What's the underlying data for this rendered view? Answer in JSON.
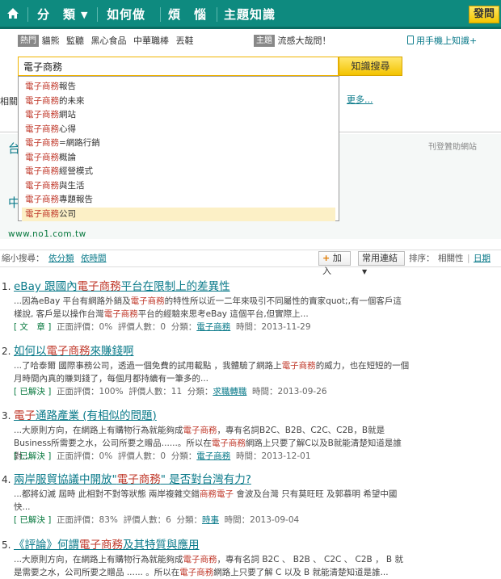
{
  "nav": {
    "items": [
      "分　類",
      "如何做",
      "煩　惱",
      "主題知識"
    ],
    "ask_label": "發問"
  },
  "hot": {
    "tag": "熱門",
    "items": [
      "貓熊",
      "監聽",
      "黑心食品",
      "中華職棒",
      "丟鞋"
    ],
    "theme_tag": "主題",
    "theme_text": "流感大哉問！",
    "mobile_text": "用手機上知識+"
  },
  "search": {
    "value": "電子商務",
    "button_label": "知識搜尋",
    "suggestions": [
      {
        "kw": "電子商務",
        "rest": "報告"
      },
      {
        "kw": "電子商務",
        "rest": "的未來"
      },
      {
        "kw": "電子商務",
        "rest": "網站"
      },
      {
        "kw": "電子商務",
        "rest": "心得"
      },
      {
        "kw": "電子商務",
        "rest": "=網路行銷"
      },
      {
        "kw": "電子商務",
        "rest": "概論"
      },
      {
        "kw": "電子商務",
        "rest": "經營模式"
      },
      {
        "kw": "電子商務",
        "rest": "與生活"
      },
      {
        "kw": "電子商務",
        "rest": "專題報告"
      },
      {
        "kw": "電子商務",
        "rest": "公司"
      }
    ]
  },
  "misc": {
    "related_prefix": "相關",
    "more": "更多...",
    "ad_label": "刊登贊助網站",
    "ad_url": "www.no1.com.tw",
    "ad_frag1": "台",
    "ad_frag2": "中"
  },
  "filter": {
    "label": "縮小搜尋：",
    "by_category": "依分類",
    "by_time": "依時間",
    "add_label": "加入",
    "links_label": "常用連結",
    "sort_label": "排序：",
    "sort_relevance": "相關性",
    "sort_date": "日期"
  },
  "results": [
    {
      "num": "1.",
      "title_pre": "eBay 跟國內",
      "title_kw": "電子商務",
      "title_post": "平台在限制上的差異性",
      "snip": [
        {
          "t": "...因為eBay 平台有網路外銷及"
        },
        {
          "t": "電子商務",
          "kw": true
        },
        {
          "t": "的特性所以近一二年來吸引不同屬性的賣家quot;,有一個客戶這樣說, 客戶是以操作台灣"
        },
        {
          "t": "電子商務",
          "kw": true
        },
        {
          "t": "平台的經驗來思考eBay 這個平台,但實際上..."
        }
      ],
      "status": "[ 文　章 ]",
      "rating": "正面評價：0%",
      "raters": "評價人數：0",
      "cat_label": "分類：",
      "cat": "電子商務",
      "time": "時間：2013-11-29"
    },
    {
      "num": "2.",
      "title_pre": "如何以",
      "title_kw": "電子商務",
      "title_post": "來賺錢啊",
      "snip": [
        {
          "t": "...了哈泰爾 國際事務公司，透過一個免費的試用載點 ，我體驗了網路上"
        },
        {
          "t": "電子商務",
          "kw": true
        },
        {
          "t": "的威力，也在短短的一個月時間內真的賺到錢了，每個月都持續有一筆多的..."
        }
      ],
      "status": "[ 已解決 ]",
      "rating": "正面評價：100%",
      "raters": "評價人數：11",
      "cat_label": "分類：",
      "cat": "求職轉職",
      "time": "時間：2013-09-26"
    },
    {
      "num": "3.",
      "title_pre": "",
      "title_kw": "電子",
      "title_post": "通路產業 (有相似的問題)",
      "snip": [
        {
          "t": "...大原則方向，在網路上有購物行為就能夠成"
        },
        {
          "t": "電子商務",
          "kw": true
        },
        {
          "t": "，專有名詞B2C、B2B、C2C、C2B，B就是Business所需要之水，公司所要之贈品......。所以在"
        },
        {
          "t": "電子商務",
          "kw": true
        },
        {
          "t": "網路上只要了解C以及B就能清楚知道是誰對..."
        }
      ],
      "status": "[ 已解決 ]",
      "rating": "正面評價：0%",
      "raters": "評價人數：0",
      "cat_label": "分類：",
      "cat": "電子商務",
      "time": "時間：2013-12-01"
    },
    {
      "num": "4.",
      "title_pre": "兩岸服貿協議中開放\"",
      "title_kw": "電子商務",
      "title_post": "\" 是否對台灣有力?",
      "snip": [
        {
          "t": "...都將幻滅 屆時 此相對不對等狀態 兩岸複雜交錯"
        },
        {
          "t": "商務電子",
          "kw": true
        },
        {
          "t": " 會波及台灣 只有莫旺旺 及郭慕明 希望中國快..."
        }
      ],
      "status": "[ 已解決 ]",
      "rating": "正面評價：83%",
      "raters": "評價人數：6",
      "cat_label": "分類：",
      "cat": "時事",
      "time": "時間：2013-09-04"
    },
    {
      "num": "5.",
      "title_pre": "《評論》何謂",
      "title_kw": "電子商務",
      "title_post": "及其特質與應用",
      "snip": [
        {
          "t": "...大原則方向，在網路上有購物行為就能夠成"
        },
        {
          "t": "電子商務",
          "kw": true
        },
        {
          "t": "，專有名詞 B2C 、 B2B 、 C2C 、 C2B ， B 就是需要之水，公司所要之贈品 ...... 。所以在"
        },
        {
          "t": "電子商務",
          "kw": true
        },
        {
          "t": "網路上只要了解 C 以及 B 就能清楚知道是誰..."
        }
      ]
    }
  ],
  "colors": {
    "nav_bg": "#0e8a7f",
    "link": "#0a7a8a",
    "keyword": "#c0392b",
    "button_yellow": "#f3c300"
  }
}
